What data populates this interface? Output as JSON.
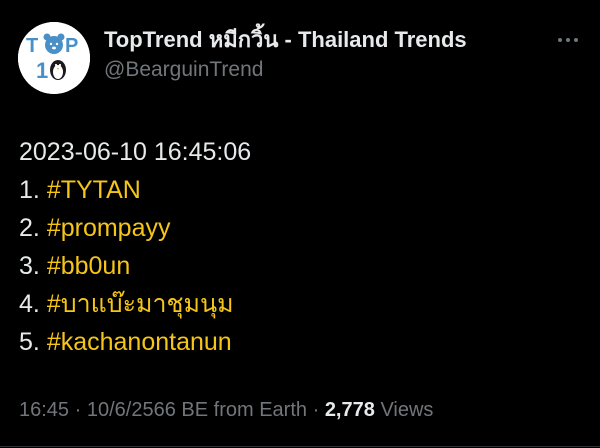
{
  "author": {
    "display_name": "TopTrend หมีกวิ้น - Thailand Trends",
    "handle": "@BearguinTrend",
    "avatar_icon": "top10-bear-penguin-logo",
    "avatar_text_top": "T P",
    "avatar_text_bottom": "10"
  },
  "more_icon": "more-horizontal-icon",
  "tweet": {
    "timestamp_line": "2023-06-10 16:45:06",
    "trends": [
      {
        "rank": "1.",
        "tag": "#TYTAN"
      },
      {
        "rank": "2.",
        "tag": "#prompayy"
      },
      {
        "rank": "3.",
        "tag": "#bb0un"
      },
      {
        "rank": "4.",
        "tag": "#บาแบ๊ะมาชุมนุม"
      },
      {
        "rank": "5.",
        "tag": "#kachanontanun"
      }
    ]
  },
  "meta": {
    "time": "16:45",
    "separator": "·",
    "date": "10/6/2566 BE",
    "source_prefix": "from",
    "source": "Earth",
    "views_count": "2,778",
    "views_label": "Views"
  },
  "colors": {
    "background": "#000000",
    "text": "#e7e9ea",
    "muted": "#71767b",
    "hashtag": "#f5c518",
    "avatar_blue": "#4a90c8"
  }
}
